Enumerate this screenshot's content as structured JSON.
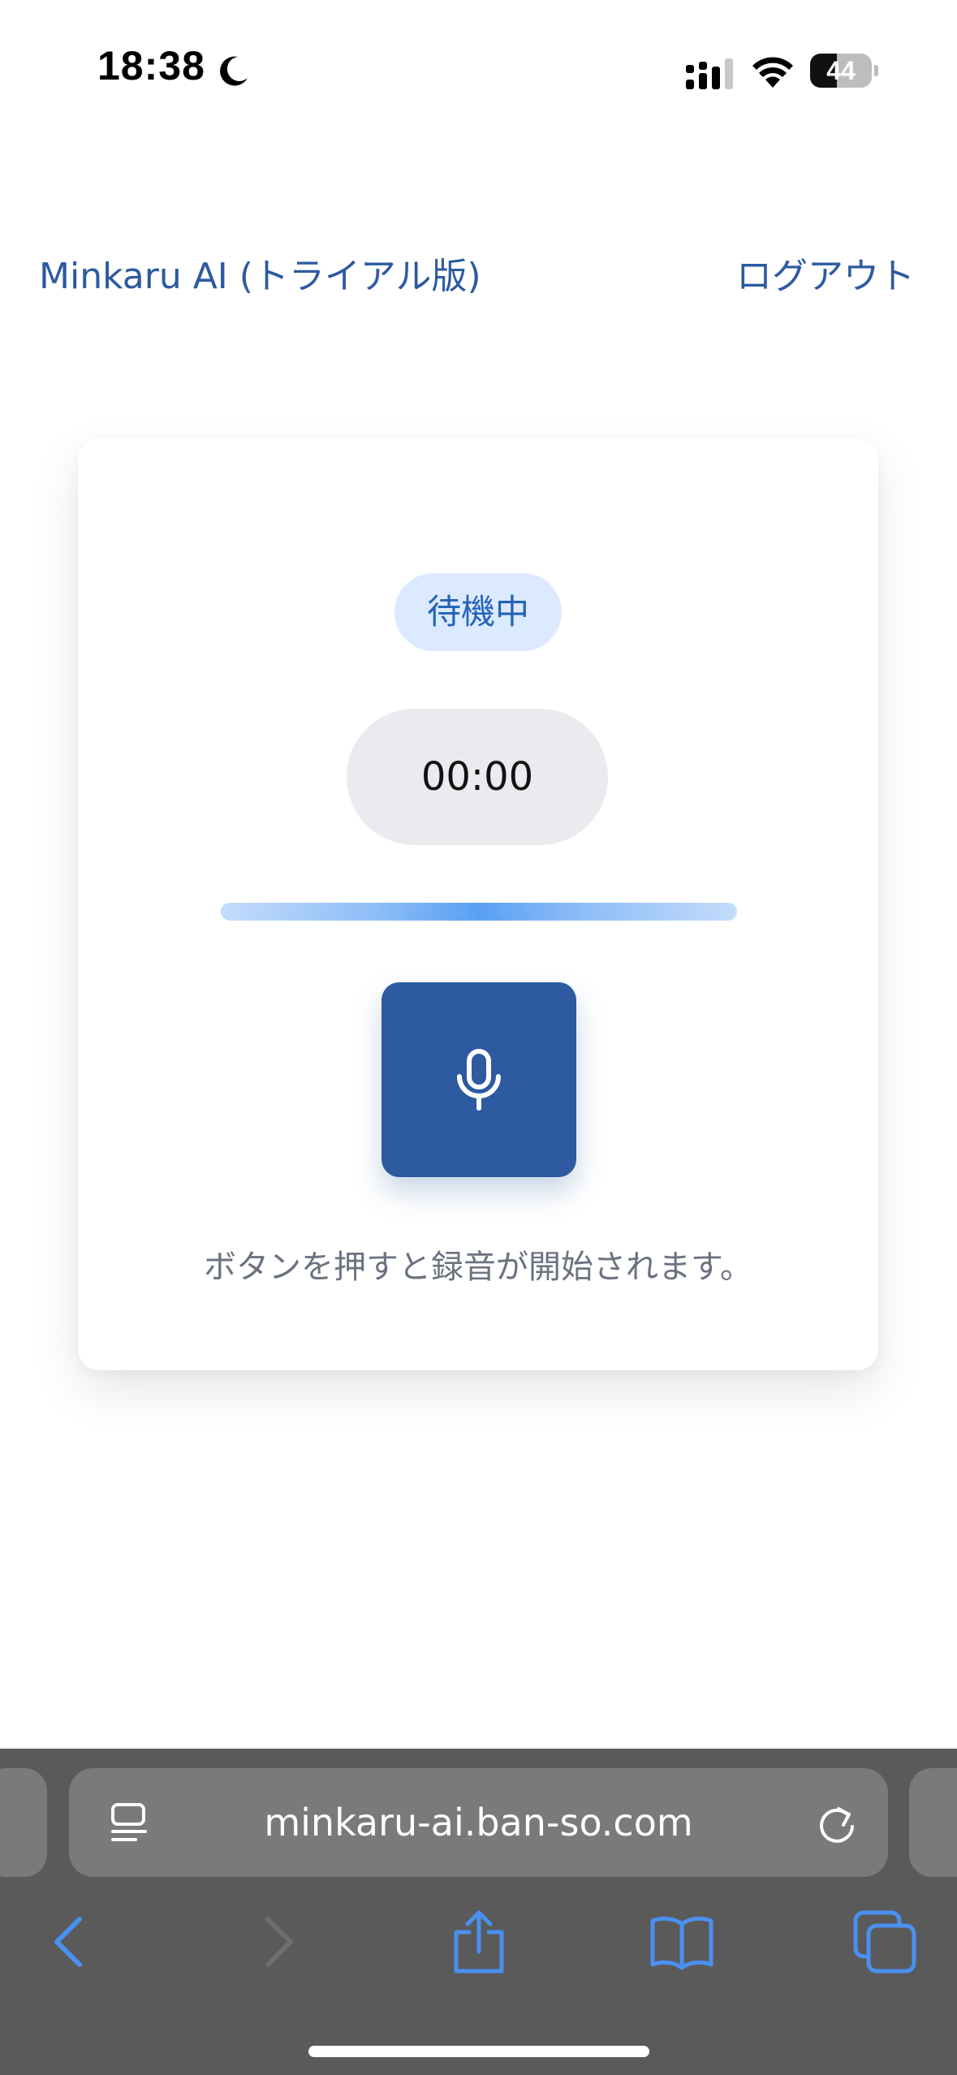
{
  "status_bar": {
    "time": "18:38",
    "battery_level": "44",
    "battery_fraction": 0.44,
    "icons": [
      "moon-icon",
      "cellular-signal-icon",
      "wifi-icon",
      "battery-icon"
    ]
  },
  "header": {
    "title": "Minkaru AI (トライアル版)",
    "logout_label": "ログアウト"
  },
  "recorder": {
    "status_label": "待機中",
    "timer": "00:00",
    "record_button_icon": "microphone-icon",
    "hint": "ボタンを押すと録音が開始されます。"
  },
  "browser": {
    "url": "minkaru-ai.ban-so.com",
    "toolbar": [
      "back-icon",
      "forward-icon",
      "share-icon",
      "bookmarks-icon",
      "tabs-icon"
    ]
  },
  "colors": {
    "accent": "#2d5aa0",
    "status_pill_bg": "#dbeafe",
    "status_pill_text": "#2563b8",
    "timer_bg": "#ebebef",
    "hint_text": "#6b7280",
    "browser_bar": "#5a5a5a",
    "browser_icons": "#4a90f0"
  }
}
